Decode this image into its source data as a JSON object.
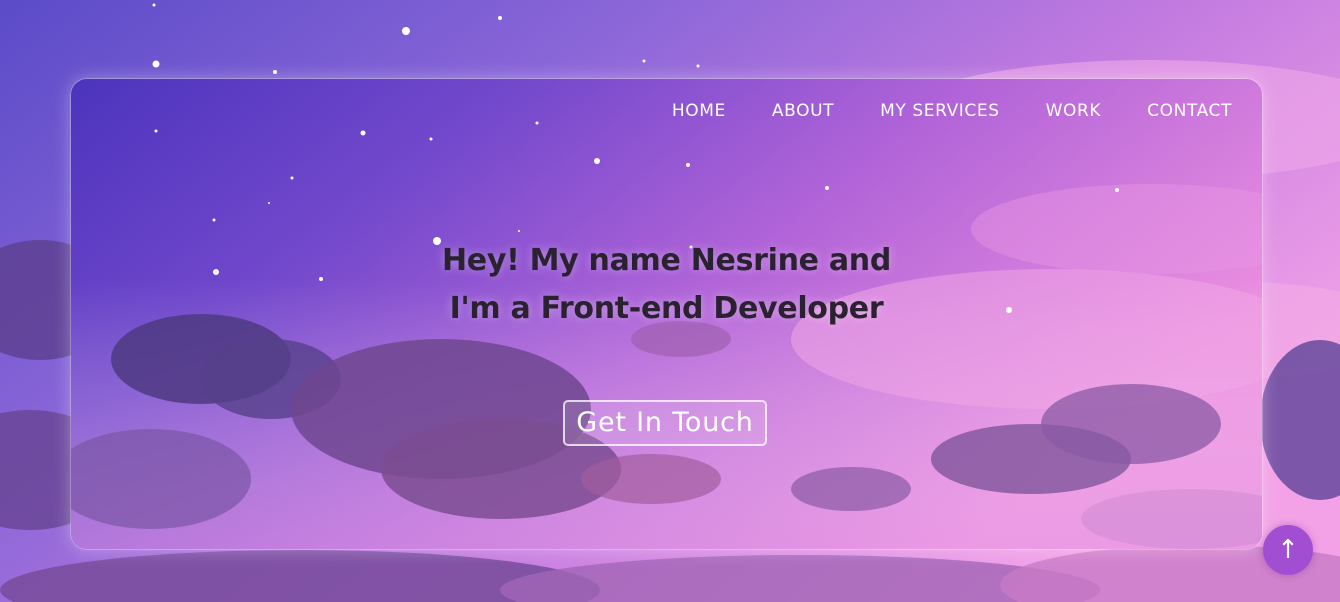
{
  "nav": {
    "items": [
      {
        "label": "HOME"
      },
      {
        "label": "ABOUT"
      },
      {
        "label": "MY SERVICES"
      },
      {
        "label": "WORK"
      },
      {
        "label": "CONTACT"
      }
    ]
  },
  "hero": {
    "headline_line1": "Hey! My name Nesrine and",
    "headline_line2": "I'm a Front-end Developer",
    "cta_label": "Get In Touch"
  },
  "scroll_top": {
    "icon": "arrow-up-icon",
    "glyph": "↑"
  },
  "colors": {
    "accent": "#a14ed3",
    "headline_text": "#2a2230",
    "nav_text": "#ffffff"
  }
}
